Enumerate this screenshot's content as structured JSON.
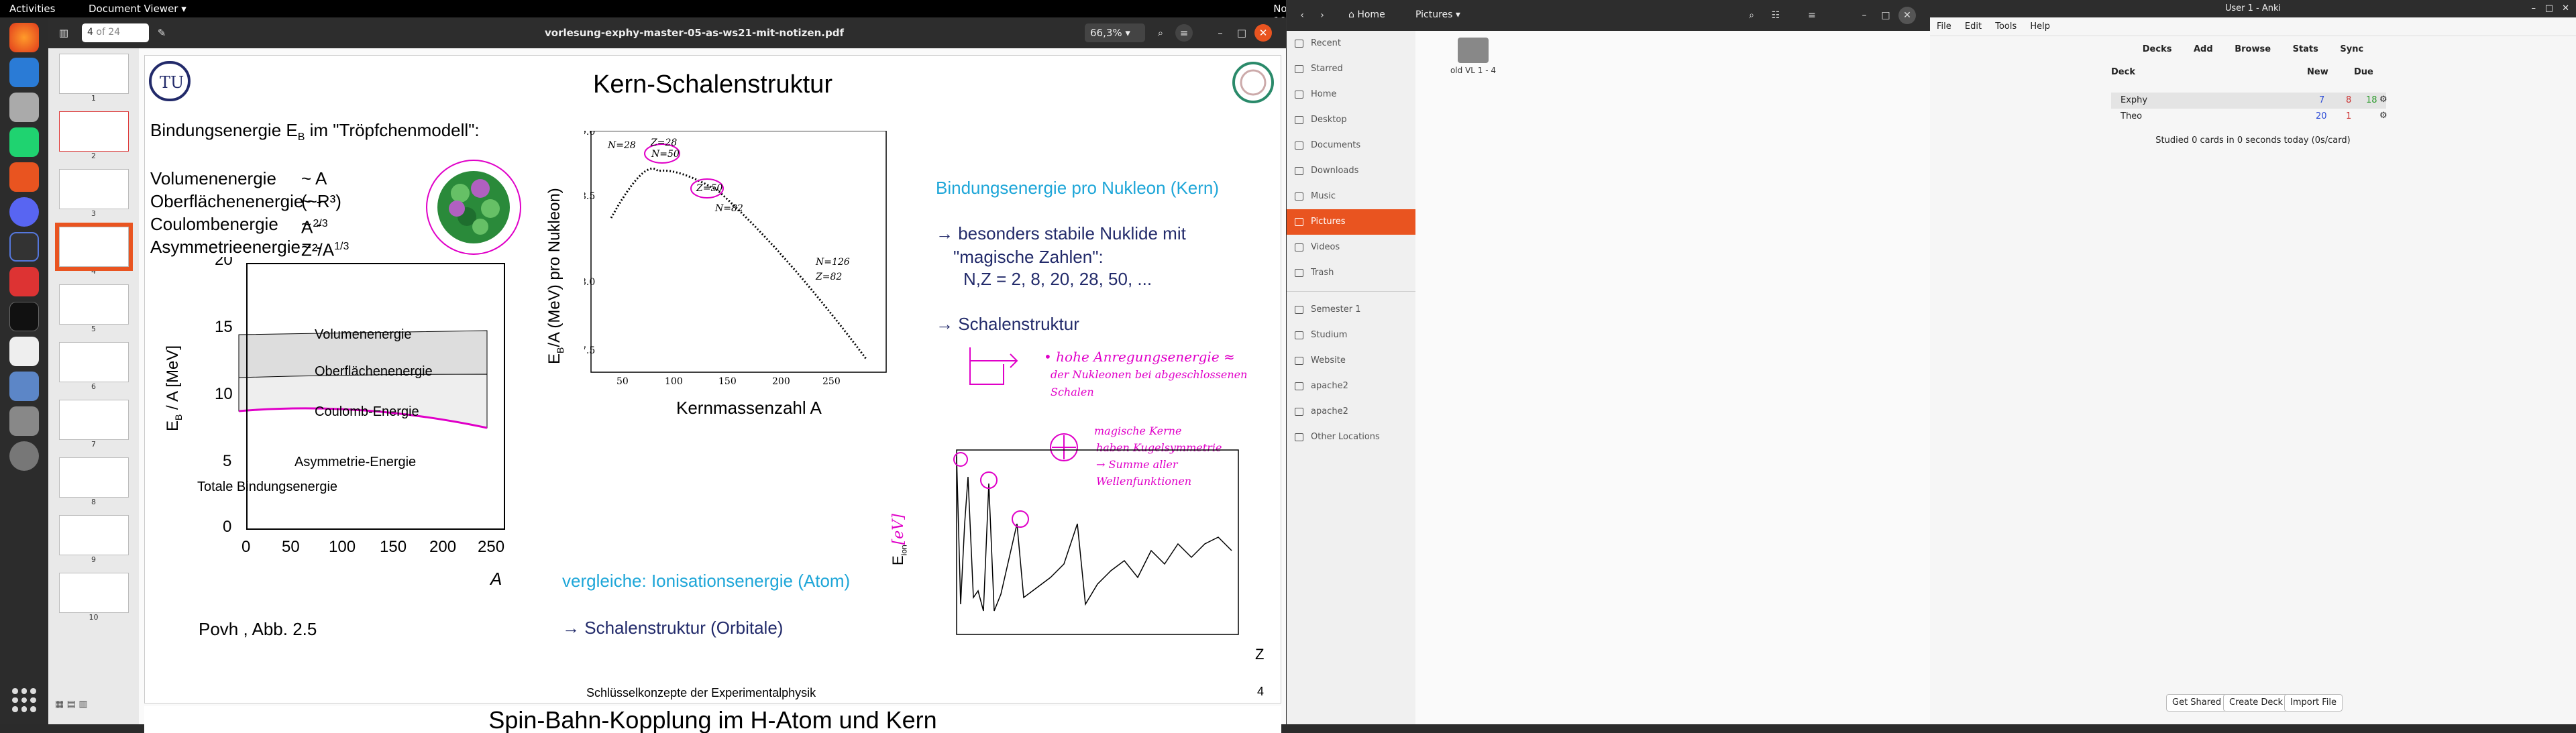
{
  "topbar": {
    "activities": "Activities",
    "app": "Document Viewer ▾",
    "clock": "Nov 6  10:35",
    "tray": "⎈ ◀ ⏻ ▾"
  },
  "viewer": {
    "page_input": "4",
    "page_of": "of 24",
    "filename": "vorlesung-exphy-master-05-as-ws21-mit-notizen.pdf",
    "zoom": "66,3%",
    "thumb_labels": [
      "1",
      "2",
      "3",
      "4",
      "5",
      "6",
      "7",
      "8",
      "9",
      "10"
    ]
  },
  "slide": {
    "title": "Kern-Schalenstruktur",
    "energy_heading": "Bindungsenergie E",
    "energy_heading_sub": "B",
    "energy_heading_rest": " im \"Tröpfchenmodell\":",
    "terms": [
      "Volumenenergie",
      "Oberflächenenergie",
      "Coulombenergie",
      "Asymmetrieenergie"
    ],
    "term_exprs": [
      "~  A    (~R³)",
      "~  -A",
      "~  -Z²/A",
      "~  -(N-Z)²/A"
    ],
    "term_exps": [
      "",
      "2/3",
      "1/3",
      ""
    ],
    "chart_labels": [
      "Volumenenergie",
      "Oberflächenenergie",
      "Coulomb-Energie",
      "Asymmetrie-Energie",
      "Totale Bindungsenergie"
    ],
    "ylabel_left": "E",
    "ylabel_left_sub": "B",
    "ylabel_left_rest": " / A [MeV]",
    "xlabel_left": "A",
    "source": "Povh , Abb. 2.5",
    "right_heading": "Bindungsenergie pro Nukleon (Kern)",
    "right_l1": "→ besonders stabile Nuklide mit",
    "right_l2": "\"magische Zahlen\":",
    "right_l3": "N,Z = 2, 8, 20, 28, 50, ...",
    "right_l4": "→ Schalenstruktur",
    "center_ylabel": "E",
    "center_ylabel_sub": "B",
    "center_ylabel_rest": "/A (MeV) pro Nukleon)",
    "center_xlabel": "Kernmassenzahl A",
    "center_marks": [
      "N=28",
      "Z=28",
      "N=50",
      "Z=50",
      "N=82",
      "N=126",
      "Z=82"
    ],
    "ion_compare": "vergleiche: Ionisationsenergie (Atom)",
    "ion_struct": "→ Schalenstruktur (Orbitale)",
    "ion_ylabel": "E",
    "ion_ylabel_sub": "ion",
    "ion_ylabel_rest": "[eV]",
    "ion_xlabel": "Z",
    "notes1": [
      "• hohe Anregungsenergie ≈",
      "der Nukleonen bei abgeschlossenen",
      "Schalen"
    ],
    "notes2": [
      "magische Kerne",
      "haben Kugelsymmetrie",
      "→ Summe aller",
      "Wellenfunktionen"
    ],
    "footer": "Schlüsselkonzepte der Experimentalphysik",
    "page_num": "4",
    "next_title": "Spin-Bahn-Kopplung im H-Atom und Kern"
  },
  "files": {
    "home": "Home",
    "pictures": "Pictures",
    "sidebar": [
      "Recent",
      "Starred",
      "Home",
      "Desktop",
      "Documents",
      "Downloads",
      "Music",
      "Pictures",
      "Videos",
      "Trash",
      "Semester 1",
      "Studium",
      "Website",
      "apache2",
      "apache2",
      "Other Locations"
    ],
    "folder": "old VL 1 - 4"
  },
  "anki": {
    "title": "User 1 - Anki",
    "menu": [
      "File",
      "Edit",
      "Tools",
      "Help"
    ],
    "nav": [
      "Decks",
      "Add",
      "Browse",
      "Stats",
      "Sync"
    ],
    "cols": [
      "Deck",
      "New",
      "Due"
    ],
    "decks": [
      {
        "name": "Exphy",
        "new": "7",
        "learn": "8",
        "due": "18"
      },
      {
        "name": "Theo",
        "new": "20",
        "learn": "1",
        "due": ""
      }
    ],
    "studied": "Studied 0 cards in 0 seconds today (0s/card)",
    "buttons": [
      "Get Shared",
      "Create Deck",
      "Import File"
    ]
  }
}
